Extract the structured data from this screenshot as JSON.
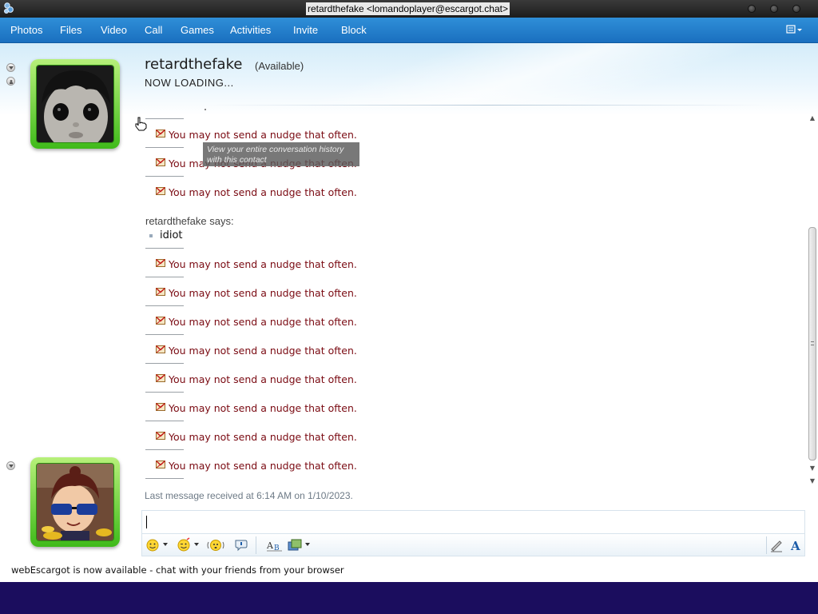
{
  "window": {
    "title": "retardthefake <lomandoplayer@escargot.chat>"
  },
  "menu": {
    "items": [
      "Photos",
      "Files",
      "Video",
      "Call",
      "Games",
      "Activities",
      "Invite",
      "Block"
    ]
  },
  "contact": {
    "name": "retardthefake",
    "status": "(Available)",
    "personal_message": "NOW LOADING..."
  },
  "conversation": {
    "tooltip": "View your entire conversation history with this contact",
    "nudge_text": "You may not send a nudge that often.",
    "entries_before": [
      "You may not send a nudge that often.",
      "You may not send a nudge that often.",
      "You may not send a nudge that often."
    ],
    "sender_line": "retardthefake says:",
    "message": "idiot",
    "entries_after": [
      "You may not send a nudge that often.",
      "You may not send a nudge that often.",
      "You may not send a nudge that often.",
      "You may not send a nudge that often.",
      "You may not send a nudge that often.",
      "You may not send a nudge that often.",
      "You may not send a nudge that often.",
      "You may not send a nudge that often."
    ]
  },
  "footer": {
    "last_message": "Last message received at 6:14 AM on 1/10/2023.",
    "input_value": "",
    "status_bar": "webEscargot is now available - chat with your friends from your browser"
  },
  "toolbar": {
    "icons": [
      "emoticon-icon",
      "wink-icon",
      "nudge-icon",
      "voice-clip-icon",
      "font-icon",
      "background-icon",
      "handwriting-icon",
      "text-style-icon"
    ]
  },
  "colors": {
    "menu_bar": "#1f7ac8",
    "nudge_text": "#7a0a12",
    "avatar_frame": "#3fba1a",
    "taskbar": "#1b0d5e"
  }
}
